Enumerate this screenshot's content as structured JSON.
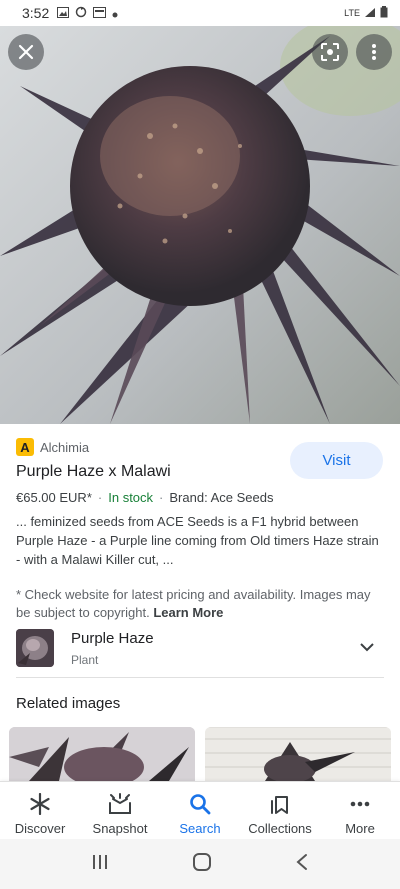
{
  "status_bar": {
    "time": "3:52",
    "network": "LTE"
  },
  "result": {
    "site": "Alchimia",
    "site_favicon_letter": "A",
    "title": "Purple Haze x Malawi",
    "price": "€65.00 EUR*",
    "stock": "In stock",
    "brand": "Brand: Ace Seeds",
    "description": "... feminized seeds from ACE Seeds is a F1 hybrid between Purple Haze - a Purple line coming from Old timers Haze strain - with a Malawi Killer cut, ...",
    "disclaimer": "* Check website for latest pricing and availability. Images may be subject to copyright.",
    "learn_more": "Learn More",
    "visit_label": "Visit"
  },
  "entity": {
    "name": "Purple Haze",
    "type": "Plant"
  },
  "related": {
    "title": "Related images"
  },
  "bottom_nav": [
    {
      "label": "Discover",
      "icon": "asterisk-icon"
    },
    {
      "label": "Snapshot",
      "icon": "snapshot-icon"
    },
    {
      "label": "Search",
      "icon": "search-icon",
      "active": true
    },
    {
      "label": "Collections",
      "icon": "collections-icon"
    },
    {
      "label": "More",
      "icon": "more-horizontal-icon"
    }
  ],
  "colors": {
    "accent": "#1a73e8",
    "stock_green": "#188038",
    "favicon": "#fbbc04"
  }
}
